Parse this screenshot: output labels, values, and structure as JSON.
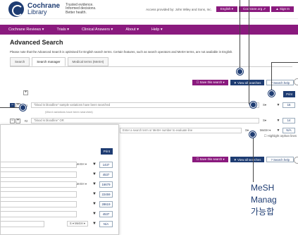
{
  "header": {
    "logo_title": "Cochrane",
    "logo_subtitle": "Library",
    "tagline": "Trusted evidence. Informed decisions. Better health.",
    "access_text": "Access provided by: John Wiley and Sons, Inc.",
    "language_btn": "English ▾",
    "cochrane_btn": "Cochrane.org ⇗",
    "signin_btn": "▲ Sign In"
  },
  "nav": {
    "items": [
      "Cochrane Reviews ▾",
      "Trials ▾",
      "Clinical Answers ▾",
      "About ▾",
      "Help ▾"
    ]
  },
  "page": {
    "title": "Advanced Search",
    "note": "Please note that the Advanced Search is optimised for English search terms. Certain features, such as search operators and MeSH terms, are not available in English."
  },
  "tabs": [
    "Search",
    "Search manager",
    "Medical terms (MeSH)"
  ],
  "actions": {
    "save": "☐ Save this search ▾",
    "view_all": "▼ View all searches",
    "search_help": "? Search help",
    "print": "Print"
  },
  "search_rows": [
    {
      "num": "#1",
      "query": "\"blood is bloodline\" sample variations have been searched",
      "limit": "S▾",
      "count": "16"
    },
    {
      "num": "#2",
      "query": "\"blood is bloodline\" OR",
      "limit": "S▾",
      "count": "14"
    },
    {
      "num": "#3",
      "query": "Enter a search term or MeSH number to evaluate line",
      "limit": "S▾",
      "mesh": "MeSH ▾",
      "count": "N/A"
    }
  ],
  "sub_note": "(Word variations have been searched)",
  "highlight_orphan": "☐ Highlight orphan lines",
  "zoom_rows": [
    {
      "limit": "MeSH ▾",
      "count": "1437"
    },
    {
      "limit": "",
      "count": "4537"
    },
    {
      "limit": "MeSH ▾",
      "count": "16679"
    },
    {
      "limit": "",
      "count": "22459"
    },
    {
      "limit": "",
      "count": "28619"
    },
    {
      "limit": "",
      "count": "4537"
    },
    {
      "limit": "S ▾  MeSH ▾",
      "count": "N/A"
    }
  ],
  "caption": {
    "line1": "MeSH",
    "line2": "Manag",
    "line3": "가능합"
  },
  "colors": {
    "brand_purple": "#8a1a7e",
    "brand_navy": "#1e3c72"
  }
}
